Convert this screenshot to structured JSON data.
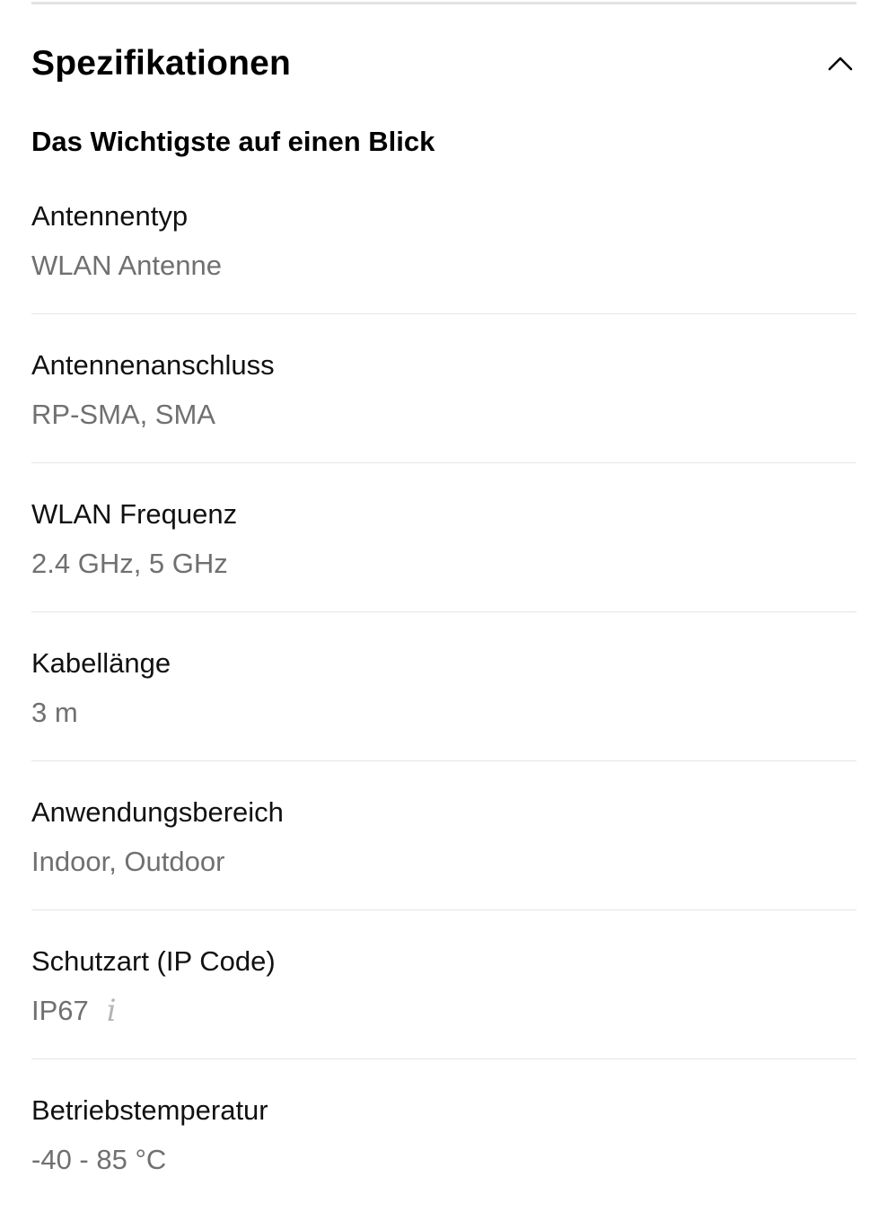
{
  "section": {
    "title": "Spezifikationen",
    "toggle_icon": "chevron-up-icon",
    "subheading": "Das Wichtigste auf einen Blick"
  },
  "specs": [
    {
      "label": "Antennentyp",
      "value": "WLAN Antenne"
    },
    {
      "label": "Antennenanschluss",
      "value": "RP-SMA, SMA"
    },
    {
      "label": "WLAN Frequenz",
      "value": "2.4 GHz, 5 GHz"
    },
    {
      "label": "Kabellänge",
      "value": "3 m"
    },
    {
      "label": "Anwendungsbereich",
      "value": "Indoor, Outdoor"
    },
    {
      "label": "Schutzart (IP Code)",
      "value": "IP67",
      "info_icon": "info-icon",
      "info_glyph": "i"
    },
    {
      "label": "Betriebstemperatur",
      "value": "-40 - 85 °C"
    }
  ],
  "colors": {
    "label": "#111111",
    "value": "#707070",
    "divider": "#e6e6e6",
    "info_icon": "#b5b5b5"
  }
}
